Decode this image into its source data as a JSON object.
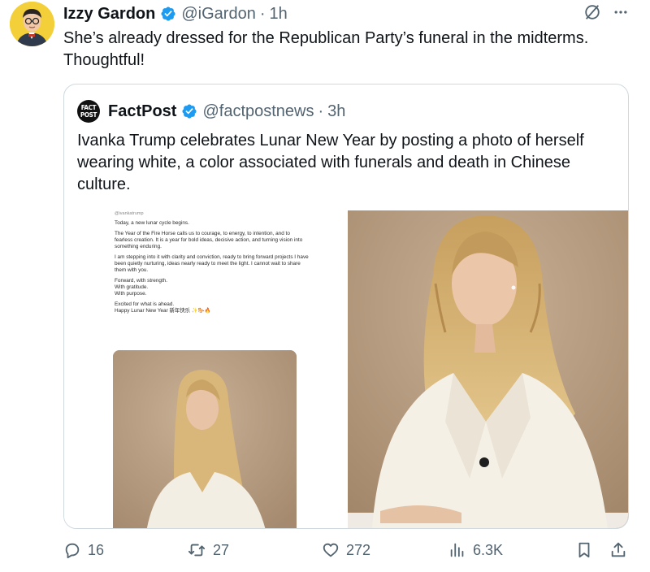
{
  "author": {
    "name": "Izzy Gardon",
    "handle": "@iGardon",
    "separator": "·",
    "time": "1h"
  },
  "tweet": {
    "text": "She’s already dressed for the Republican Party’s funeral in the midterms.\nThoughtful!"
  },
  "quoted": {
    "logo_text": "FACT POST",
    "name": "FactPost",
    "handle": "@factpostnews",
    "separator": "·",
    "time": "3h",
    "text": "Ivanka Trump celebrates Lunar New Year by posting a photo of herself wearing white, a color associated with funerals and death in Chinese culture.",
    "screenshot": {
      "top_handle": "@ivankatrump",
      "lines": [
        "Today, a new lunar cycle begins.",
        "The Year of the Fire Horse calls us to courage, to energy, to intention, and to fearless creation. It is a year for bold ideas, decisive action, and turning vision into something enduring.",
        "I am stepping into it with clarity and conviction, ready to bring forward projects I have been quietly nurturing, ideas nearly ready to meet the light. I cannot wait to share them with you.",
        "Forward, with strength.\nWith gratitude.\nWith purpose.",
        "Excited for what is ahead.\nHappy Lunar New Year 新年快乐 ✨🐎🔥"
      ]
    }
  },
  "actions": {
    "replies": "16",
    "reposts": "27",
    "likes": "272",
    "views": "6.3K"
  },
  "colors": {
    "verified": "#1d9bf0",
    "secondary_text": "#536471",
    "border": "#cfd9de"
  }
}
